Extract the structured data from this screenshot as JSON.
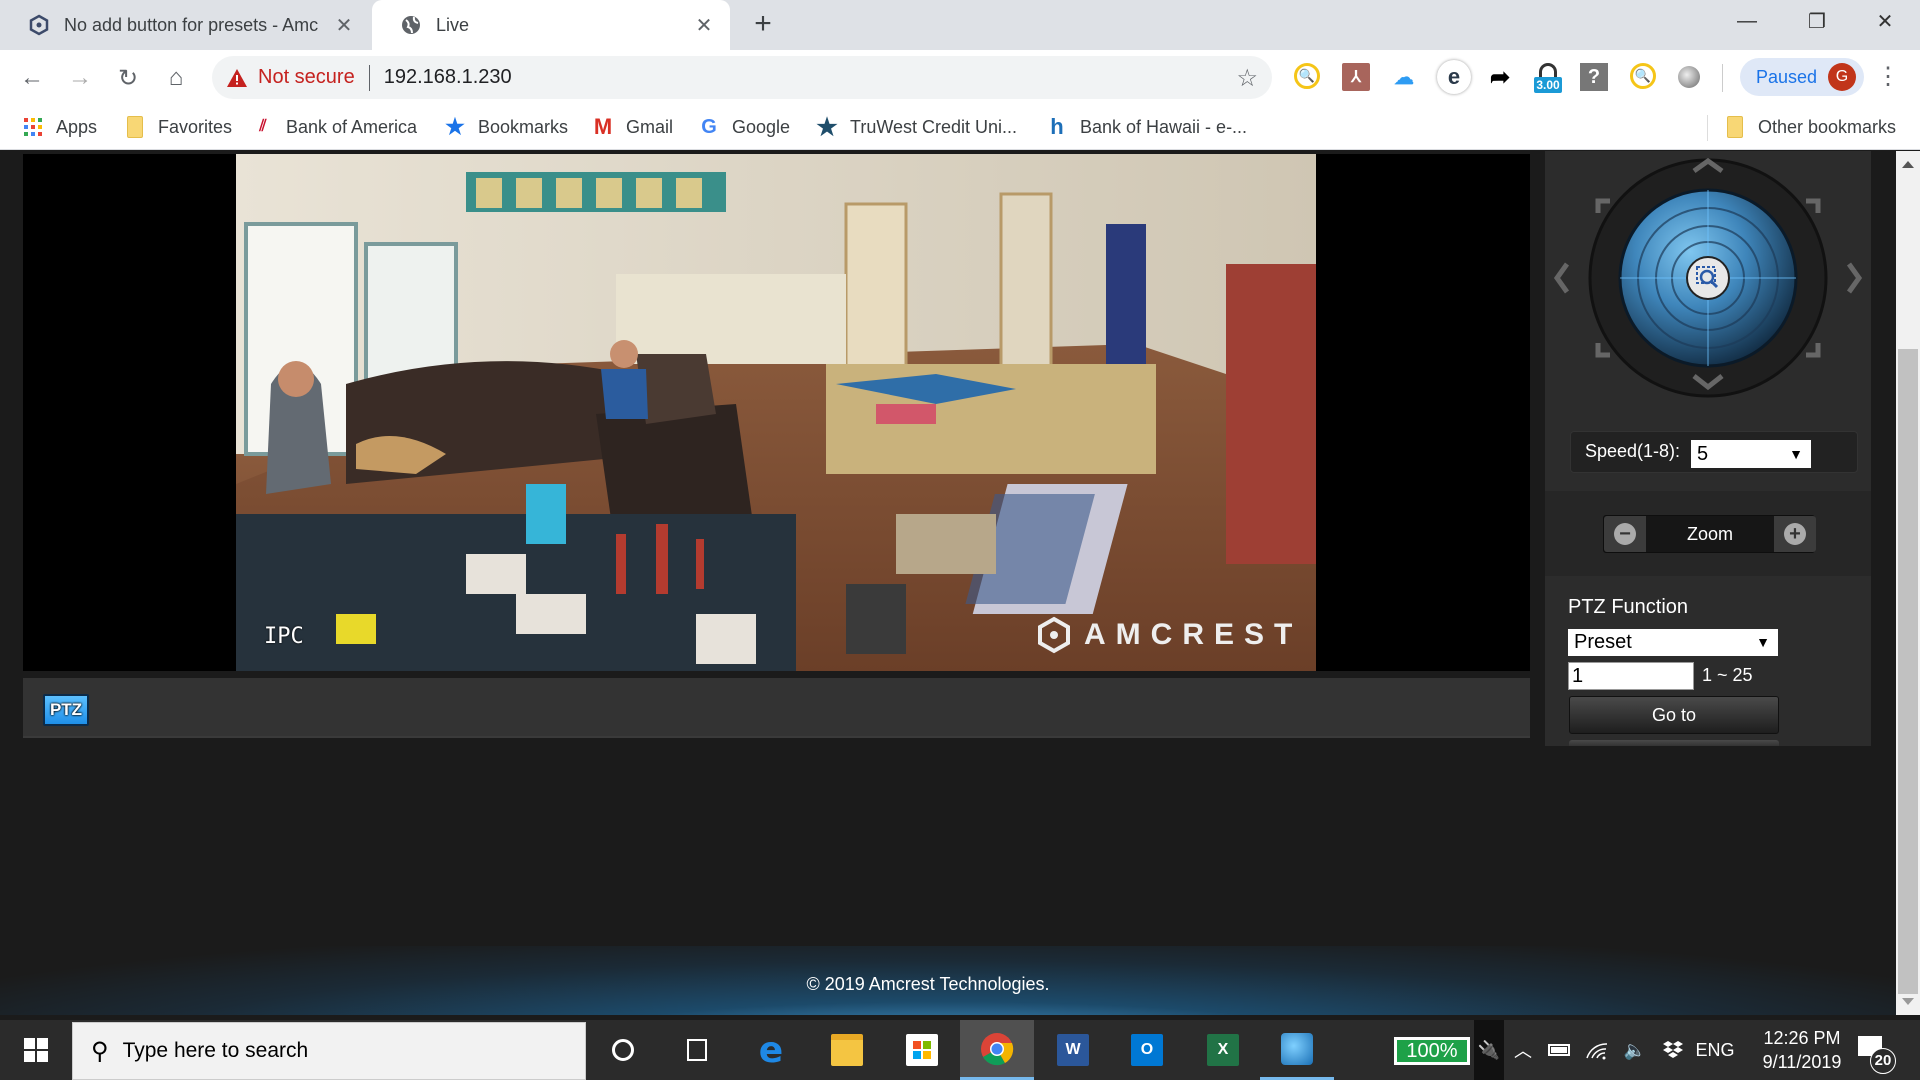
{
  "browser": {
    "tabs": [
      {
        "title": "No add button for presets - Amc",
        "icon": "amcrest-icon",
        "active": false
      },
      {
        "title": "Live",
        "icon": "globe-icon",
        "active": true
      }
    ],
    "new_tab_label": "+",
    "window_controls": {
      "minimize": "—",
      "restore": "❐",
      "close": "✕"
    },
    "nav": {
      "back": "←",
      "forward": "→",
      "reload": "↻",
      "home": "⌂"
    },
    "omnibox": {
      "security_label": "Not secure",
      "url": "192.168.1.230"
    },
    "extensions": [
      {
        "name": "search-extension-icon"
      },
      {
        "name": "acrobat-extension-icon"
      },
      {
        "name": "icloud-extension-icon"
      },
      {
        "name": "e-extension-icon"
      },
      {
        "name": "share-arrow-extension-icon"
      },
      {
        "name": "lock-extension-icon",
        "badge": "3.00"
      },
      {
        "name": "help-extension-icon"
      },
      {
        "name": "search-extension-icon-2"
      },
      {
        "name": "circle-extension-icon"
      }
    ],
    "profile": {
      "status": "Paused",
      "initial": "G"
    },
    "bookmarks": [
      {
        "label": "Apps",
        "icon": "apps-grid-icon"
      },
      {
        "label": "Favorites",
        "icon": "folder-icon"
      },
      {
        "label": "Bank of America",
        "icon": "bank-of-america-icon"
      },
      {
        "label": "Bookmarks",
        "icon": "star-icon"
      },
      {
        "label": "Gmail",
        "icon": "gmail-icon"
      },
      {
        "label": "Google",
        "icon": "google-icon"
      },
      {
        "label": "TruWest Credit Uni...",
        "icon": "truwest-star-icon"
      },
      {
        "label": "Bank of Hawaii - e-...",
        "icon": "bank-of-hawaii-icon"
      }
    ],
    "other_bookmarks": "Other bookmarks"
  },
  "camera": {
    "overlay_label": "IPC",
    "watermark": "AMCREST",
    "toolbar_ptz_label": "PTZ"
  },
  "ptz_panel": {
    "speed_label": "Speed(1-8):",
    "speed_value": "5",
    "zoom_label": "Zoom",
    "zoom_minus": "−",
    "zoom_plus": "+",
    "function_title": "PTZ Function",
    "function_value": "Preset",
    "preset_value": "1",
    "preset_range": "1 ~ 25",
    "goto_label": "Go to"
  },
  "footer": {
    "copyright": "© 2019 Amcrest Technologies."
  },
  "taskbar": {
    "search_placeholder": "Type here to search",
    "apps": [
      {
        "name": "cortana",
        "label": "O"
      },
      {
        "name": "task-view",
        "label": ""
      },
      {
        "name": "edge",
        "label": "e"
      },
      {
        "name": "file-explorer",
        "label": ""
      },
      {
        "name": "store",
        "label": ""
      },
      {
        "name": "chrome",
        "label": ""
      },
      {
        "name": "word",
        "label": "W"
      },
      {
        "name": "outlook",
        "label": "O"
      },
      {
        "name": "excel",
        "label": "X"
      },
      {
        "name": "network-app",
        "label": ""
      }
    ],
    "battery_percent": "100%",
    "language": "ENG",
    "time": "12:26 PM",
    "date": "9/11/2019",
    "notification_count": "20"
  }
}
